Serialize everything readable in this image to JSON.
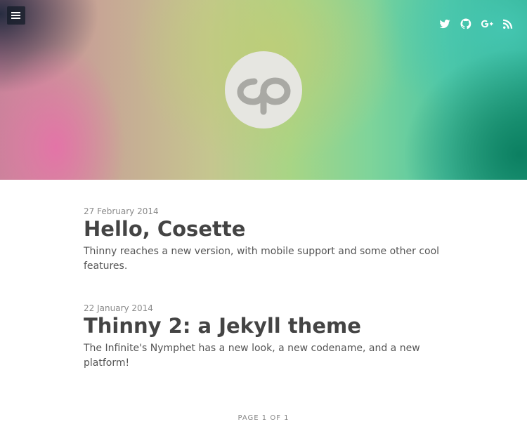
{
  "header": {
    "menu_icon": "hamburger-menu-icon",
    "logo_icon": "cp-logo-icon",
    "social": [
      {
        "name": "twitter-icon"
      },
      {
        "name": "github-icon"
      },
      {
        "name": "google-plus-icon"
      },
      {
        "name": "rss-icon"
      }
    ]
  },
  "posts": [
    {
      "date": "27 February 2014",
      "title": "Hello, Cosette",
      "excerpt": "Thinny reaches a new version, with mobile support and some other cool features."
    },
    {
      "date": "22 January 2014",
      "title": "Thinny 2: a Jekyll theme",
      "excerpt": "The Infinite's Nymphet has a new look, a new codename, and a new platform!"
    }
  ],
  "pagination": {
    "label": "PAGE 1 OF 1"
  },
  "colors": {
    "title": "#444444",
    "date": "#8a8a8a",
    "excerpt": "#555555",
    "logo_bg": "#e6e6e1",
    "logo_fg": "#a9a9a4"
  }
}
